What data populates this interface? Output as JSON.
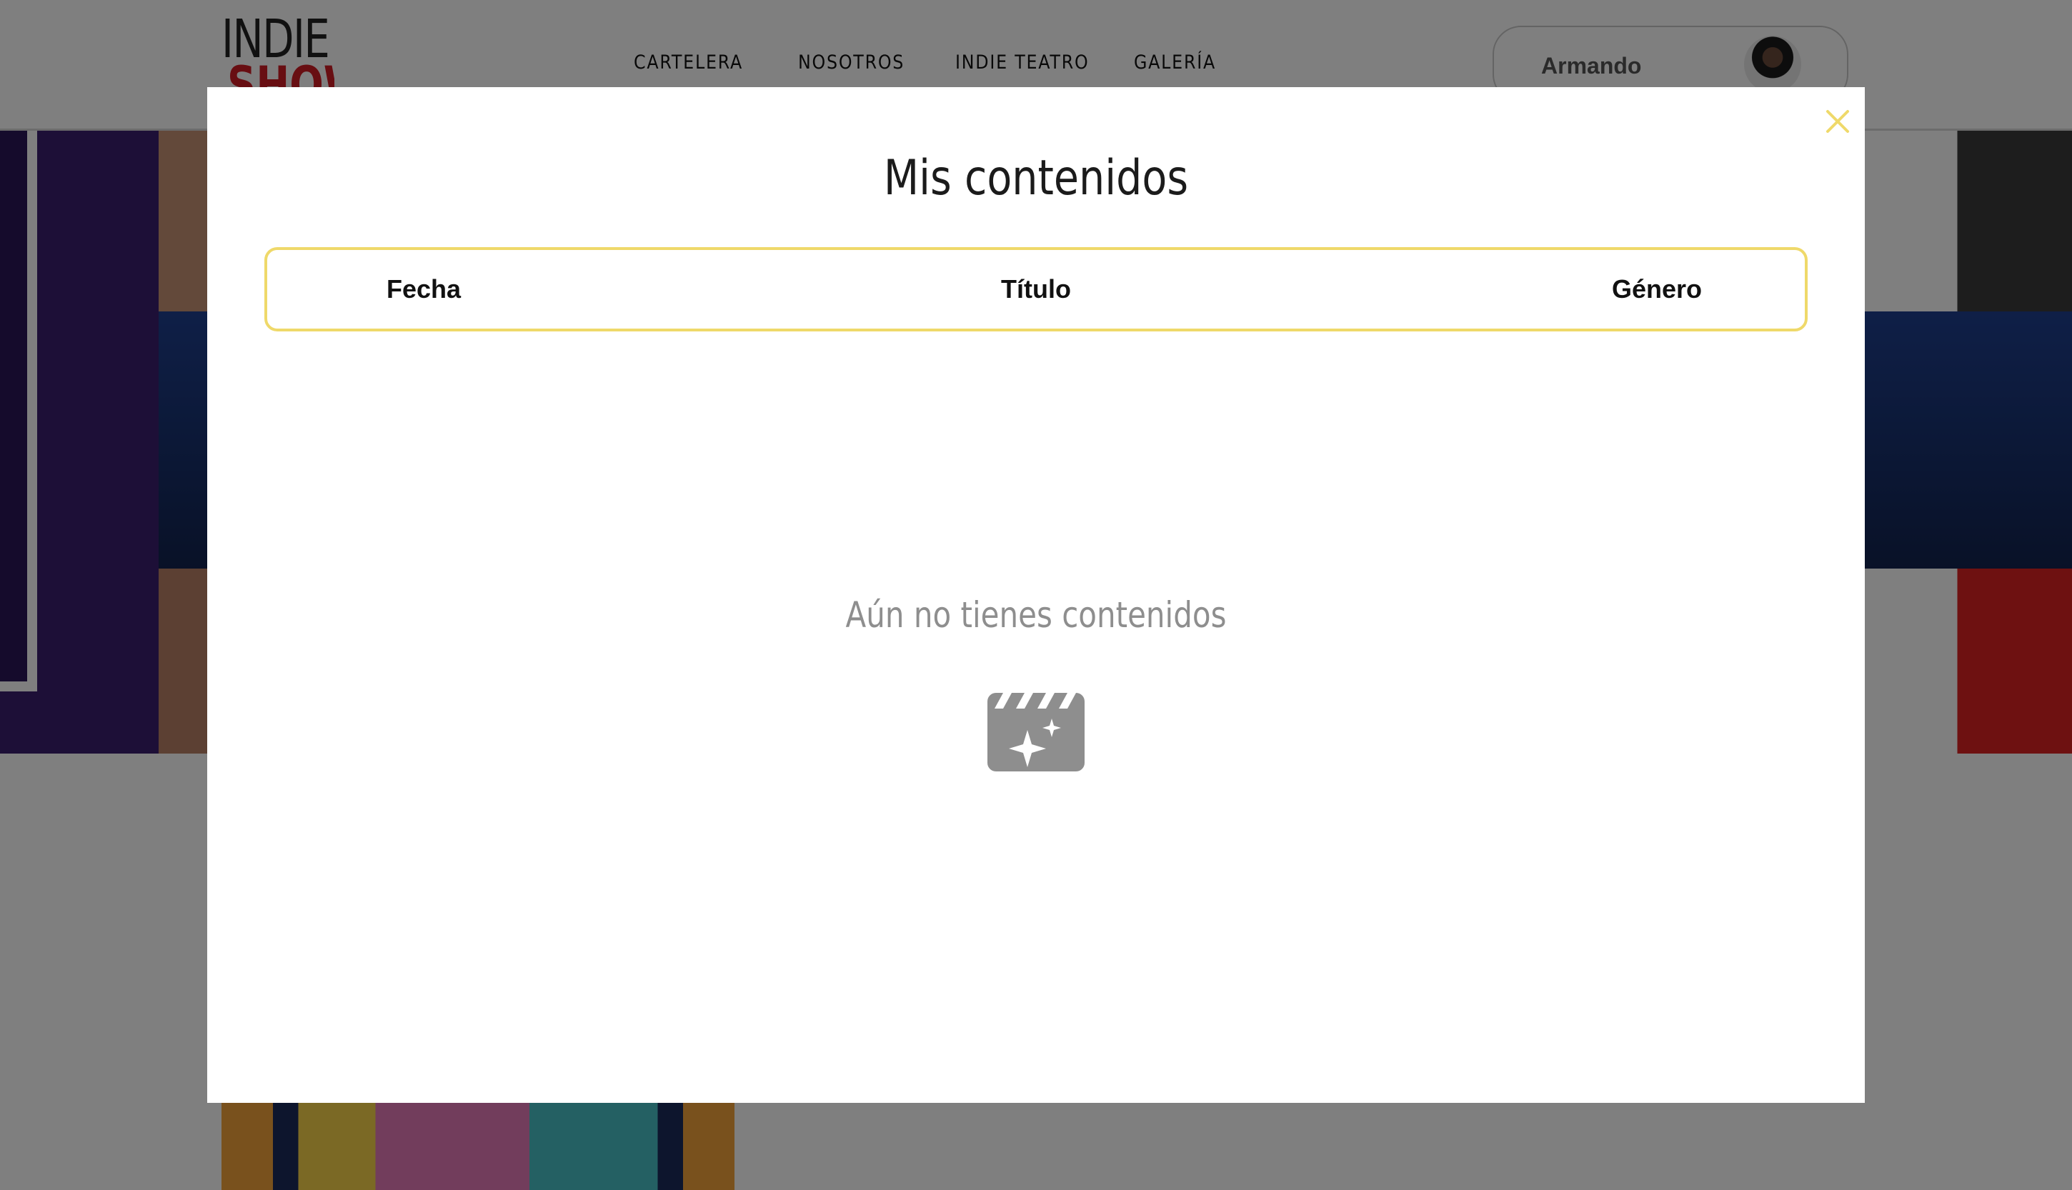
{
  "header": {
    "logo_line1": "INDIE",
    "logo_line2": "SHOW",
    "nav": [
      "CARTELERA",
      "NOSOTROS",
      "INDIE TEATRO",
      "GALERÍA"
    ],
    "user_name": "Armando"
  },
  "modal": {
    "title": "Mis contenidos",
    "sort_options": {
      "date": "Fecha",
      "title": "Título",
      "genre": "Género"
    },
    "empty_message": "Aún no tienes contenidos",
    "close_icon": "close-icon",
    "empty_icon": "movie-clapper-sparkle-icon"
  },
  "colors": {
    "accent_yellow": "#efd96a",
    "brand_red": "#d11d24",
    "overlay": "rgba(0,0,0,0.5)",
    "muted_text": "#8e8e8e"
  }
}
